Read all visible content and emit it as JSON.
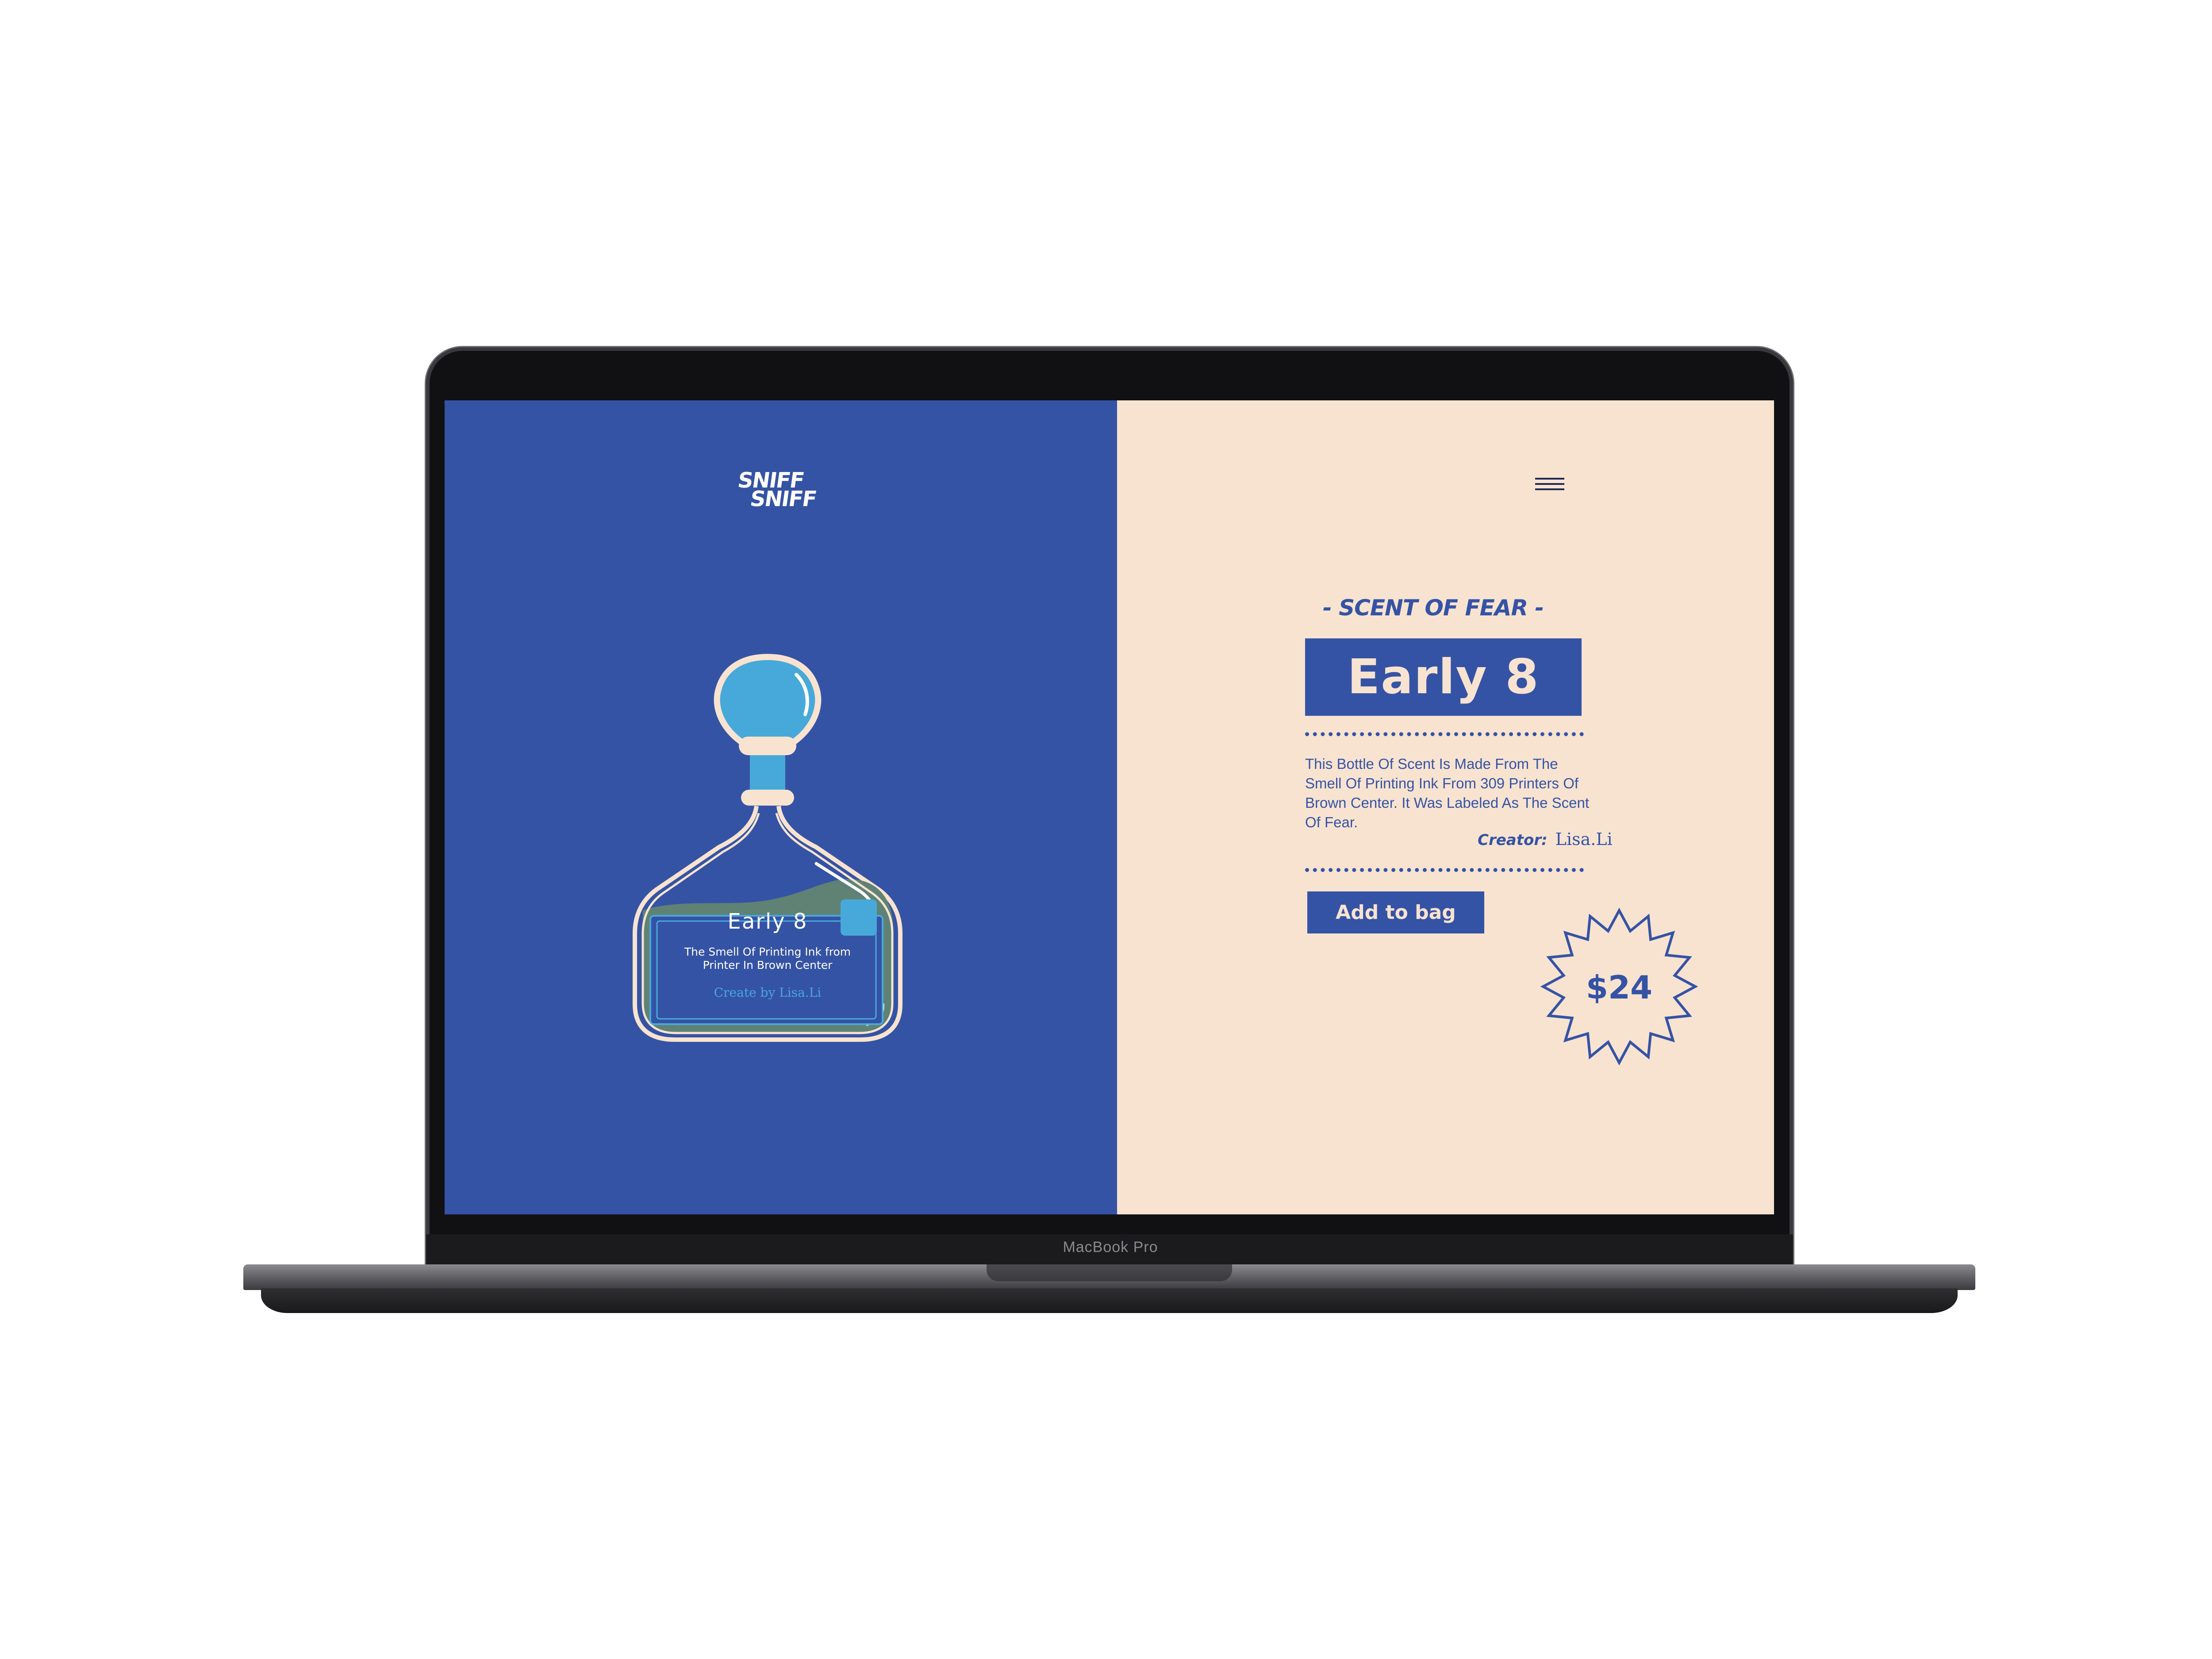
{
  "device": {
    "model_label": "MacBook Pro"
  },
  "site": {
    "logo_line1": "SNIFF",
    "logo_line2": "SNIFF"
  },
  "colors": {
    "primary_blue": "#3553a5",
    "cream": "#f7e3d0",
    "light_blue": "#47a9d9",
    "green_ink": "#5f8275"
  },
  "menu": {
    "icon": "hamburger-menu-icon"
  },
  "product": {
    "eyebrow": "- SCENT OF FEAR -",
    "title": "Early 8",
    "description": "This Bottle Of Scent Is Made From The Smell Of Printing Ink From 309 Printers Of Brown Center. It Was Labeled As The Scent Of Fear.",
    "creator_label": "Creator:",
    "creator_name": "Lisa.Li",
    "add_to_bag": "Add to bag",
    "price": "$24"
  },
  "bottle_label": {
    "title": "Early 8",
    "subtitle_line1": "The Smell Of Printing Ink from",
    "subtitle_line2": "Printer In Brown Center",
    "creator": "Create by Lisa.Li"
  }
}
